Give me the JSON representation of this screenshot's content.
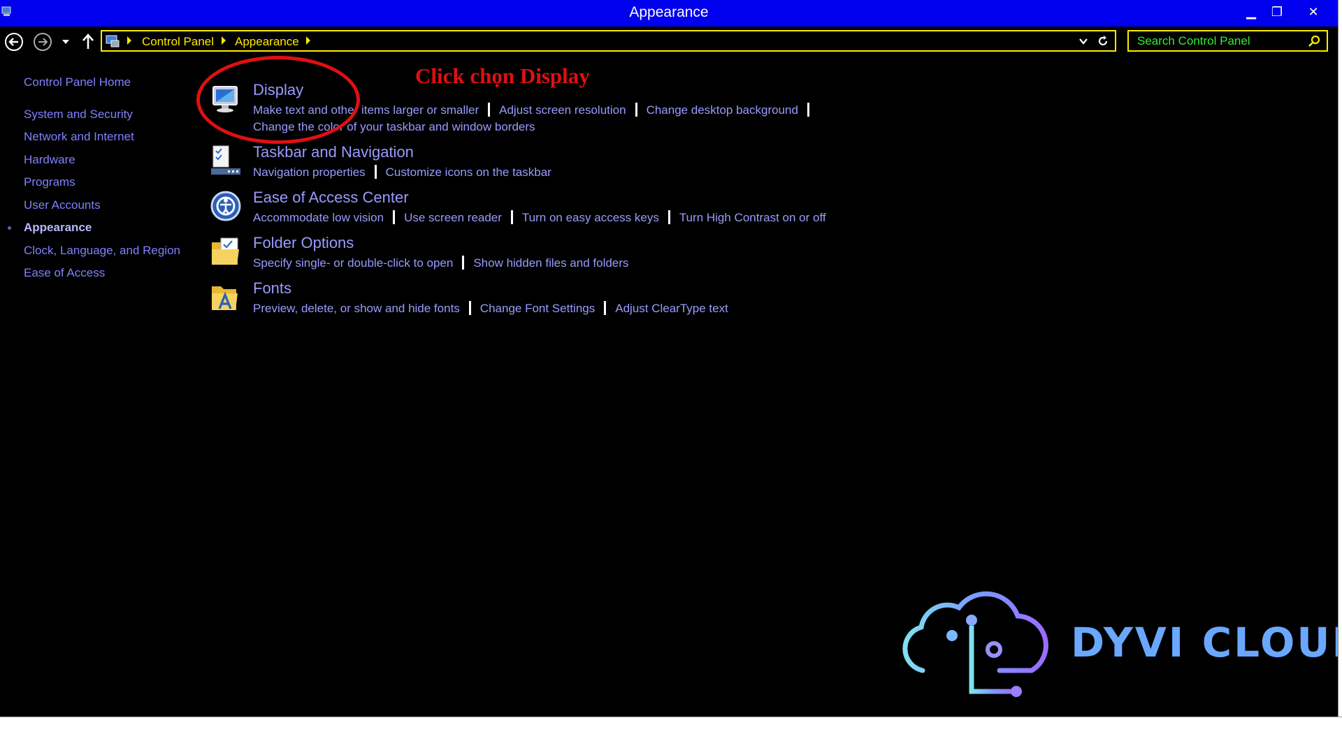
{
  "window": {
    "title": "Appearance",
    "minimize_label": "▁",
    "restore_label": "❐",
    "close_label": "✕"
  },
  "address_bar": {
    "breadcrumbs": [
      "Control Panel",
      "Appearance"
    ],
    "search_placeholder": "Search Control Panel"
  },
  "sidebar": {
    "home": "Control Panel Home",
    "items": [
      {
        "label": "System and Security"
      },
      {
        "label": "Network and Internet"
      },
      {
        "label": "Hardware"
      },
      {
        "label": "Programs"
      },
      {
        "label": "User Accounts"
      },
      {
        "label": "Appearance",
        "active": true
      },
      {
        "label": "Clock, Language, and Region"
      },
      {
        "label": "Ease of Access"
      }
    ]
  },
  "categories": [
    {
      "title": "Display",
      "icon": "monitor-icon",
      "links": [
        "Make text and other items larger or smaller",
        "Adjust screen resolution",
        "Change desktop background"
      ],
      "links2": [
        "Change the color of your taskbar and window borders"
      ]
    },
    {
      "title": "Taskbar and Navigation",
      "icon": "taskbar-icon",
      "links": [
        "Navigation properties",
        "Customize icons on the taskbar"
      ]
    },
    {
      "title": "Ease of Access Center",
      "icon": "ease-of-access-icon",
      "links": [
        "Accommodate low vision",
        "Use screen reader",
        "Turn on easy access keys",
        "Turn High Contrast on or off"
      ]
    },
    {
      "title": "Folder Options",
      "icon": "folder-icon",
      "links": [
        "Specify single- or double-click to open",
        "Show hidden files and folders"
      ]
    },
    {
      "title": "Fonts",
      "icon": "fonts-folder-icon",
      "links": [
        "Preview, delete, or show and hide fonts",
        "Change Font Settings",
        "Adjust ClearType text"
      ]
    }
  ],
  "annotation": {
    "text": "Click chọn Display",
    "color": "#e01010"
  },
  "watermark": {
    "text": "DYVI CLOUD"
  },
  "colors": {
    "titlebar": "#0000ee",
    "address_text": "#ffea00",
    "link": "#9a9aff",
    "search_text": "#00ff00"
  }
}
